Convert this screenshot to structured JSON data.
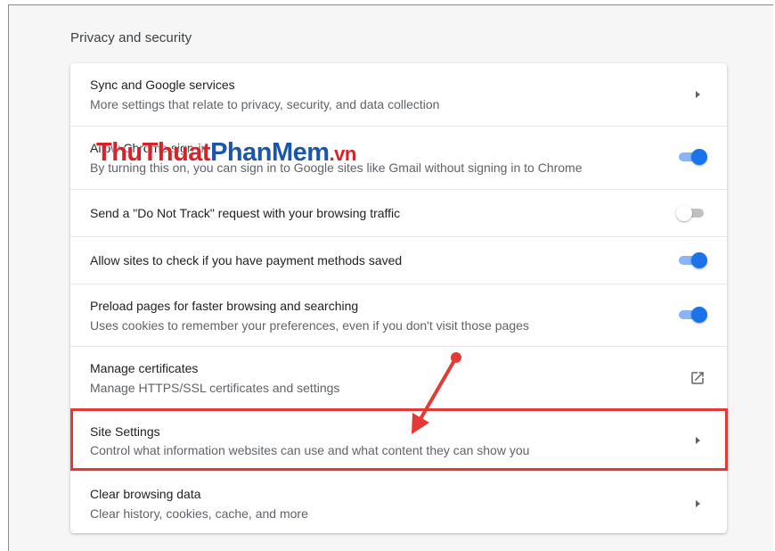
{
  "section": {
    "title": "Privacy and security"
  },
  "rows": [
    {
      "label": "Sync and Google services",
      "sub": "More settings that relate to privacy, security, and data collection",
      "control": "arrow"
    },
    {
      "label": "Allow Chrome sign-in",
      "sub": "By turning this on, you can sign in to Google sites like Gmail without signing in to Chrome",
      "control": "toggle",
      "state": "on"
    },
    {
      "label": "Send a \"Do Not Track\" request with your browsing traffic",
      "control": "toggle",
      "state": "off"
    },
    {
      "label": "Allow sites to check if you have payment methods saved",
      "control": "toggle",
      "state": "on"
    },
    {
      "label": "Preload pages for faster browsing and searching",
      "sub": "Uses cookies to remember your preferences, even if you don't visit those pages",
      "control": "toggle",
      "state": "on"
    },
    {
      "label": "Manage certificates",
      "sub": "Manage HTTPS/SSL certificates and settings",
      "control": "external-link-icon"
    },
    {
      "label": "Site Settings",
      "sub": "Control what information websites can use and what content they can show you",
      "control": "arrow",
      "highlighted": true
    },
    {
      "label": "Clear browsing data",
      "sub": "Clear history, cookies, cache, and more",
      "control": "arrow"
    }
  ],
  "watermark": {
    "part1": "ThuThuat",
    "part2": "PhanMem",
    "part3": ".vn"
  },
  "colors": {
    "accent": "#1a73e8",
    "toggle_track_on": "#8ab4f8",
    "toggle_track_off": "#bdc1c6",
    "annotation": "#e53935",
    "watermark_red": "#d6232a",
    "watermark_blue": "#1b56a8"
  }
}
